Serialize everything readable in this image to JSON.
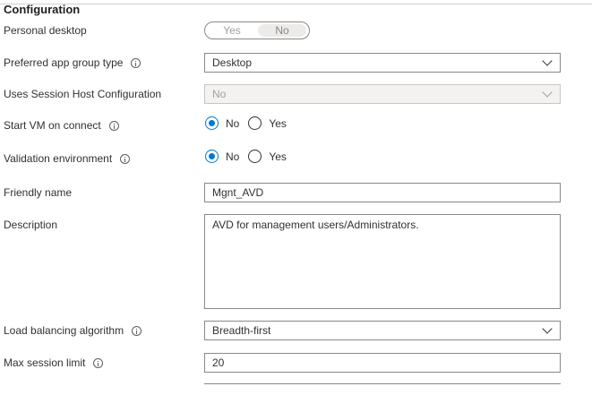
{
  "section_title": "Configuration",
  "personal_desktop": {
    "label": "Personal desktop",
    "yes": "Yes",
    "no": "No",
    "selected": "No"
  },
  "preferred_app_group_type": {
    "label": "Preferred app group type",
    "value": "Desktop"
  },
  "uses_session_host_config": {
    "label": "Uses Session Host Configuration",
    "value": "No"
  },
  "start_vm_on_connect": {
    "label": "Start VM on connect",
    "options": [
      "No",
      "Yes"
    ],
    "selected": "No"
  },
  "validation_environment": {
    "label": "Validation environment",
    "options": [
      "No",
      "Yes"
    ],
    "selected": "No"
  },
  "friendly_name": {
    "label": "Friendly name",
    "value": "Mgnt_AVD"
  },
  "description": {
    "label": "Description",
    "value": "AVD for management users/Administrators."
  },
  "load_balancing_algorithm": {
    "label": "Load balancing algorithm",
    "value": "Breadth-first"
  },
  "max_session_limit": {
    "label": "Max session limit",
    "value": "20"
  },
  "colors": {
    "accent": "#0078d4",
    "border": "#8a8886",
    "disabled_bg": "#f3f2f1"
  }
}
